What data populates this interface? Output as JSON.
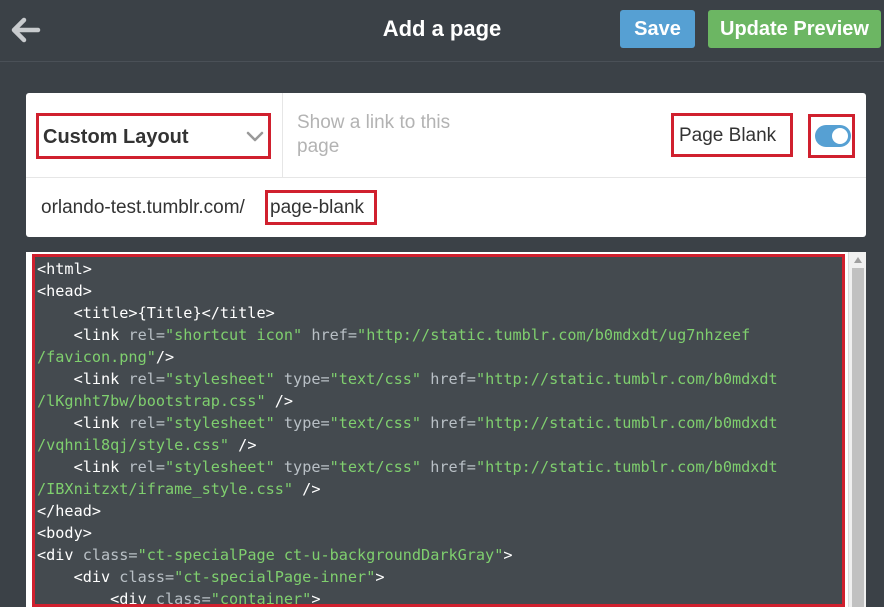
{
  "header": {
    "back_icon": "arrow-left-icon",
    "title": "Add a page",
    "save_label": "Save",
    "update_preview_label": "Update Preview"
  },
  "settings": {
    "layout_select": {
      "value": "Custom Layout",
      "icon": "chevron-down-icon"
    },
    "show_link_label": "Show a link to this page",
    "page_title": "Page Blank",
    "show_link_toggle": {
      "on": true
    }
  },
  "url": {
    "base": "orlando-test.tumblr.com/",
    "slug": "page-blank"
  },
  "editor": {
    "lines": [
      [
        {
          "t": "tag",
          "v": "<html>"
        }
      ],
      [
        {
          "t": "tag",
          "v": "<head>"
        }
      ],
      [
        {
          "t": "tag",
          "v": "    <title>{Title}</title>"
        }
      ],
      [
        {
          "t": "tag",
          "v": "    <link "
        },
        {
          "t": "attr",
          "v": "rel="
        },
        {
          "t": "str",
          "v": "\"shortcut icon\""
        },
        {
          "t": "tag",
          "v": " "
        },
        {
          "t": "attr",
          "v": "href="
        },
        {
          "t": "str",
          "v": "\"http://static.tumblr.com/b0mdxdt/ug7nhzeef"
        }
      ],
      [
        {
          "t": "str",
          "v": "/favicon.png\""
        },
        {
          "t": "tag",
          "v": "/>"
        }
      ],
      [
        {
          "t": "tag",
          "v": "    <link "
        },
        {
          "t": "attr",
          "v": "rel="
        },
        {
          "t": "str",
          "v": "\"stylesheet\""
        },
        {
          "t": "tag",
          "v": " "
        },
        {
          "t": "attr",
          "v": "type="
        },
        {
          "t": "str",
          "v": "\"text/css\""
        },
        {
          "t": "tag",
          "v": " "
        },
        {
          "t": "attr",
          "v": "href="
        },
        {
          "t": "str",
          "v": "\"http://static.tumblr.com/b0mdxdt"
        }
      ],
      [
        {
          "t": "str",
          "v": "/lKgnht7bw/bootstrap.css\""
        },
        {
          "t": "tag",
          "v": " />"
        }
      ],
      [
        {
          "t": "tag",
          "v": "    <link "
        },
        {
          "t": "attr",
          "v": "rel="
        },
        {
          "t": "str",
          "v": "\"stylesheet\""
        },
        {
          "t": "tag",
          "v": " "
        },
        {
          "t": "attr",
          "v": "type="
        },
        {
          "t": "str",
          "v": "\"text/css\""
        },
        {
          "t": "tag",
          "v": " "
        },
        {
          "t": "attr",
          "v": "href="
        },
        {
          "t": "str",
          "v": "\"http://static.tumblr.com/b0mdxdt"
        }
      ],
      [
        {
          "t": "str",
          "v": "/vqhnil8qj/style.css\""
        },
        {
          "t": "tag",
          "v": " />"
        }
      ],
      [
        {
          "t": "tag",
          "v": "    <link "
        },
        {
          "t": "attr",
          "v": "rel="
        },
        {
          "t": "str",
          "v": "\"stylesheet\""
        },
        {
          "t": "tag",
          "v": " "
        },
        {
          "t": "attr",
          "v": "type="
        },
        {
          "t": "str",
          "v": "\"text/css\""
        },
        {
          "t": "tag",
          "v": " "
        },
        {
          "t": "attr",
          "v": "href="
        },
        {
          "t": "str",
          "v": "\"http://static.tumblr.com/b0mdxdt"
        }
      ],
      [
        {
          "t": "str",
          "v": "/IBXnitzxt/iframe_style.css\""
        },
        {
          "t": "tag",
          "v": " />"
        }
      ],
      [
        {
          "t": "tag",
          "v": "</head>"
        }
      ],
      [
        {
          "t": "tag",
          "v": "<body>"
        }
      ],
      [
        {
          "t": "tag",
          "v": "<div "
        },
        {
          "t": "attr",
          "v": "class="
        },
        {
          "t": "str",
          "v": "\"ct-specialPage ct-u-backgroundDarkGray\""
        },
        {
          "t": "tag",
          "v": ">"
        }
      ],
      [
        {
          "t": "tag",
          "v": "    <div "
        },
        {
          "t": "attr",
          "v": "class="
        },
        {
          "t": "str",
          "v": "\"ct-specialPage-inner\""
        },
        {
          "t": "tag",
          "v": ">"
        }
      ],
      [
        {
          "t": "tag",
          "v": "        <div "
        },
        {
          "t": "attr",
          "v": "class="
        },
        {
          "t": "str",
          "v": "\"container\""
        },
        {
          "t": "tag",
          "v": ">"
        }
      ]
    ]
  },
  "colors": {
    "header_bg": "#3b4147",
    "save_button": "#56a0d3",
    "update_preview_button": "#6cb663",
    "highlight_border": "#d0202e",
    "code_bg": "#444a4f",
    "code_string": "#7fcf6e"
  }
}
